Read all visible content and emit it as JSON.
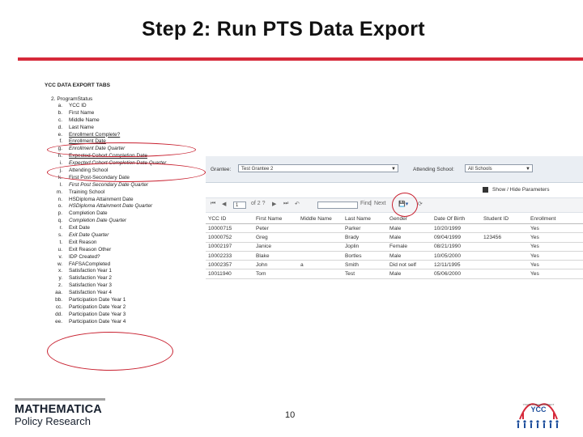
{
  "slide": {
    "title": "Step 2: Run PTS Data Export",
    "page_number": "10"
  },
  "tabs_panel": {
    "heading": "YCC DATA EXPORT TABS",
    "section": "2.  ProgramStatus",
    "items": [
      {
        "letter": "a.",
        "text": "YCC ID",
        "style": "normal"
      },
      {
        "letter": "b.",
        "text": "First Name",
        "style": "normal"
      },
      {
        "letter": "c.",
        "text": "Middle Name",
        "style": "normal"
      },
      {
        "letter": "d.",
        "text": "Last Name",
        "style": "normal"
      },
      {
        "letter": "e.",
        "text": "Enrollment Complete?",
        "style": "underline"
      },
      {
        "letter": "f.",
        "text": "Enrollment Date",
        "style": "underline"
      },
      {
        "letter": "g.",
        "text": "Enrollment Date Quarter",
        "style": "italic"
      },
      {
        "letter": "h.",
        "text": "Expected Cohort Completion Date",
        "style": "underline"
      },
      {
        "letter": "i.",
        "text": "Expected Cohort Completion Date Quarter",
        "style": "italic"
      },
      {
        "letter": "j.",
        "text": "Attending School",
        "style": "normal"
      },
      {
        "letter": "k.",
        "text": "First Post-Secondary Date",
        "style": "normal"
      },
      {
        "letter": "l.",
        "text": "First Post Secondary Date Quarter",
        "style": "italic"
      },
      {
        "letter": "m.",
        "text": "Training School",
        "style": "normal"
      },
      {
        "letter": "n.",
        "text": "HSDiploma Attainment Date",
        "style": "normal"
      },
      {
        "letter": "o.",
        "text": "HSDiploma Attainment Date Quarter",
        "style": "italic"
      },
      {
        "letter": "p.",
        "text": "Completion Date",
        "style": "normal"
      },
      {
        "letter": "q.",
        "text": "Completion Date Quarter",
        "style": "italic"
      },
      {
        "letter": "r.",
        "text": "Exit Date",
        "style": "normal"
      },
      {
        "letter": "s.",
        "text": "Exit Date Quarter",
        "style": "italic"
      },
      {
        "letter": "t.",
        "text": "Exit Reason",
        "style": "normal"
      },
      {
        "letter": "u.",
        "text": "Exit Reason Other",
        "style": "normal"
      },
      {
        "letter": "v.",
        "text": "IDP Created?",
        "style": "normal"
      },
      {
        "letter": "w.",
        "text": "FAFSACompleted",
        "style": "normal"
      },
      {
        "letter": "x.",
        "text": "Satisfaction Year 1",
        "style": "normal"
      },
      {
        "letter": "y.",
        "text": "Satisfaction Year 2",
        "style": "normal"
      },
      {
        "letter": "z.",
        "text": "Satisfaction Year 3",
        "style": "normal"
      },
      {
        "letter": "aa.",
        "text": "Satisfaction Year 4",
        "style": "normal"
      },
      {
        "letter": "bb.",
        "text": "Participation Date Year 1",
        "style": "normal"
      },
      {
        "letter": "cc.",
        "text": "Participation Date Year 2",
        "style": "normal"
      },
      {
        "letter": "dd.",
        "text": "Participation Date Year 3",
        "style": "normal"
      },
      {
        "letter": "ee.",
        "text": "Participation Date Year 4",
        "style": "normal"
      }
    ]
  },
  "report": {
    "grantee_label": "Grantee:",
    "grantee_value": "Test Grantee 2",
    "school_label": "Attending School:",
    "school_value": "All Schools",
    "params_toggle": "Show / Hide Parameters",
    "page_current": "1",
    "page_total": "of 2 ?",
    "find_label": "Find",
    "next_label": "Next",
    "columns": [
      "YCC ID",
      "First Name",
      "Middle Name",
      "Last Name",
      "Gender",
      "Date Of Birth",
      "Student ID",
      "Enrollment"
    ],
    "rows": [
      [
        "10000715",
        "Peter",
        "",
        "Parker",
        "Male",
        "10/20/1999",
        "",
        "Yes"
      ],
      [
        "10000752",
        "Greg",
        "",
        "Brady",
        "Male",
        "09/04/1999",
        "123456",
        "Yes"
      ],
      [
        "10002197",
        "Janice",
        "",
        "Joplin",
        "Female",
        "08/21/1990",
        "",
        "Yes"
      ],
      [
        "10002233",
        "Blake",
        "",
        "Bortles",
        "Male",
        "10/05/2000",
        "",
        "Yes"
      ],
      [
        "10002357",
        "John",
        "a",
        "Smith",
        "Did not self",
        "12/11/1995",
        "",
        "Yes"
      ],
      [
        "10011940",
        "Tom",
        "",
        "Test",
        "Male",
        "05/06/2000",
        "",
        "Yes"
      ]
    ]
  },
  "footer": {
    "logo_line1": "MATHEMATICA",
    "logo_line2": "Policy Research",
    "ycc_logo_text": "YCC",
    "ycc_logo_caption": "YOUTH CAREERCONNECT"
  },
  "colors": {
    "accent_rule": "#d6293a",
    "annotation_circle": "#c8202f"
  }
}
